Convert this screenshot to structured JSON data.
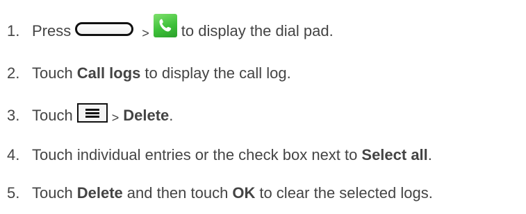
{
  "steps": [
    {
      "number": "1.",
      "text_a": "Press",
      "sep": ">",
      "text_b": "to display the dial pad."
    },
    {
      "number": "2.",
      "text_a": "Touch",
      "bold_a": "Call logs",
      "text_b": "to display the call log."
    },
    {
      "number": "3.",
      "text_a": "Touch",
      "sep": ">",
      "bold_a": "Delete",
      "text_b": "."
    },
    {
      "number": "4.",
      "text_a": "Touch individual entries or the check box next to",
      "bold_a": "Select all",
      "text_b": "."
    },
    {
      "number": "5.",
      "text_a": "Touch",
      "bold_a": "Delete",
      "text_b": "and then touch",
      "bold_b": "OK",
      "text_c": "to clear the selected logs."
    }
  ],
  "icons": {
    "home_button": "home-button-icon",
    "phone": "phone-icon",
    "menu": "menu-icon"
  },
  "colors": {
    "text": "#444444",
    "phone_green": "#3ec13a"
  }
}
